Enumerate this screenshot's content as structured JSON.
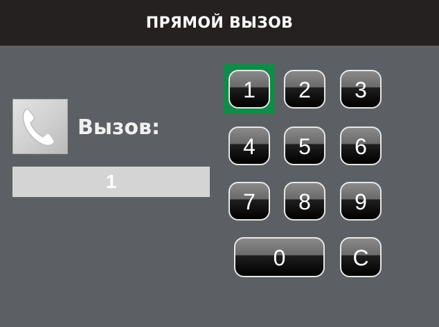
{
  "header": {
    "title": "ПРЯМОЙ ВЫЗОВ"
  },
  "call": {
    "label": "Вызов:",
    "number": "1",
    "icon": "phone-handset-icon"
  },
  "keypad": {
    "selected_key": "1",
    "selected_color": "#0e8c48",
    "keys": [
      "1",
      "2",
      "3",
      "4",
      "5",
      "6",
      "7",
      "8",
      "9",
      "0",
      "C"
    ]
  }
}
